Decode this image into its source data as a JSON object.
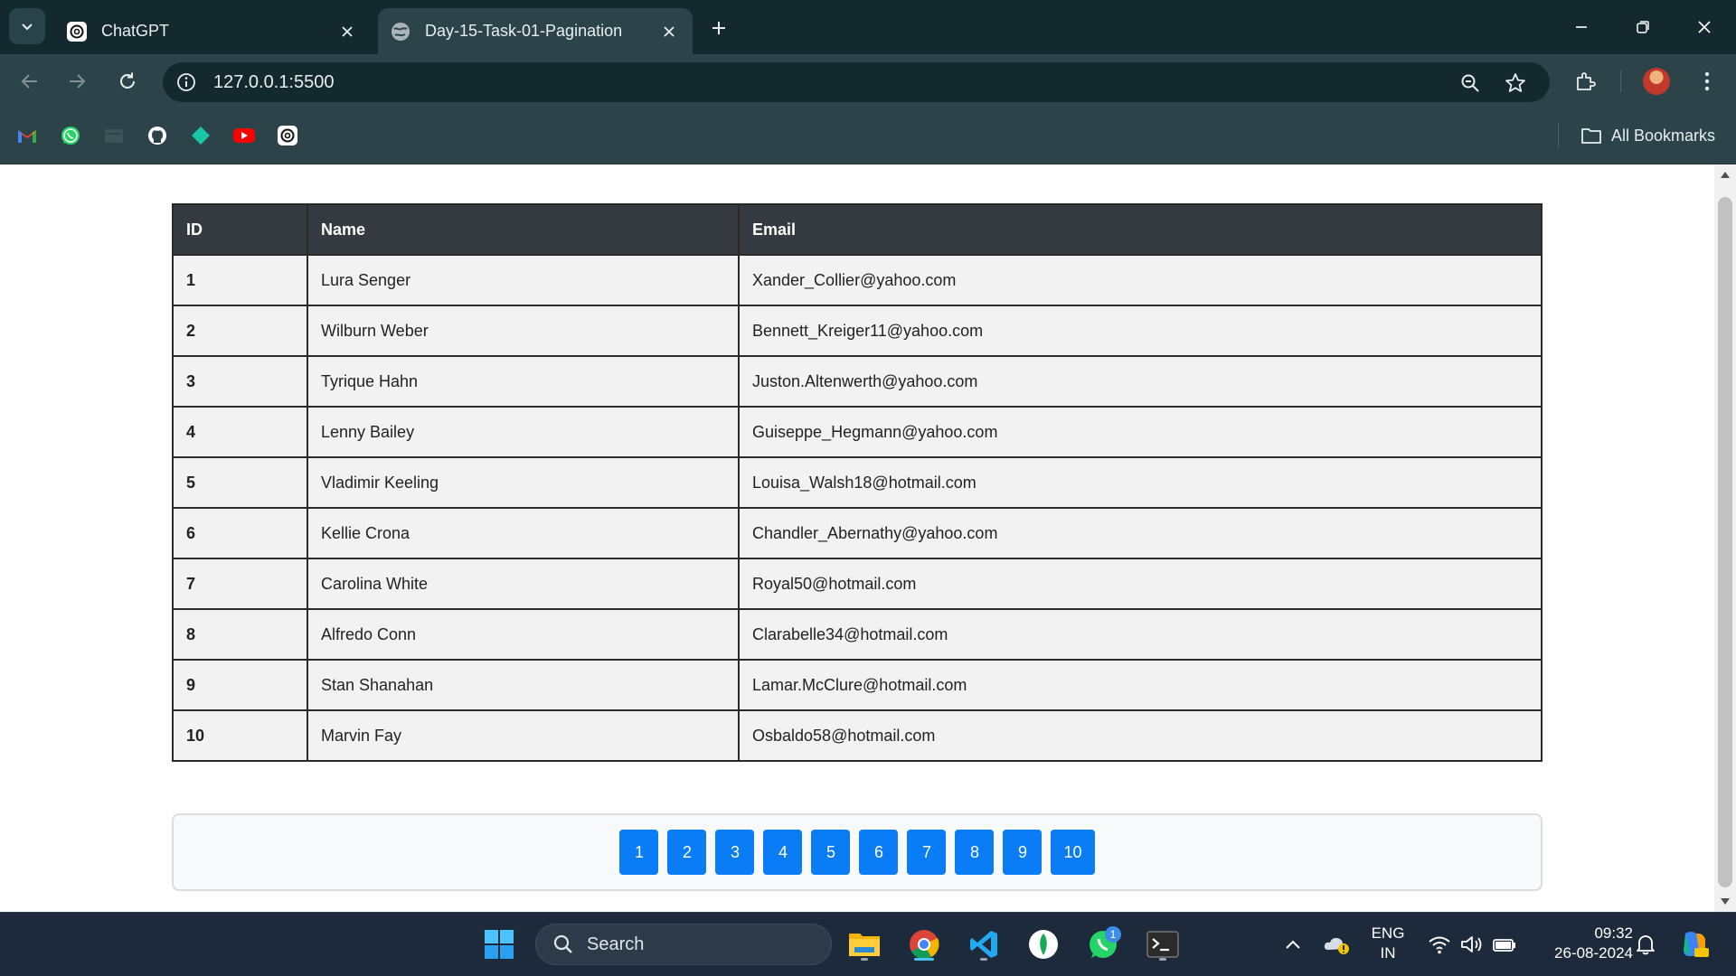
{
  "browser": {
    "tabs": [
      {
        "title": "ChatGPT",
        "favicon": "chatgpt-icon",
        "active": false
      },
      {
        "title": "Day-15-Task-01-Pagination",
        "favicon": "globe-icon",
        "active": true
      }
    ],
    "address_bar": {
      "url": "127.0.0.1:5500"
    },
    "bookmarks_bar": {
      "items": [
        "gmail-icon",
        "whatsapp-icon",
        "folder-icon",
        "github-icon",
        "diamond-icon",
        "youtube-icon",
        "chatgpt-icon"
      ],
      "all_bookmarks_label": "All Bookmarks"
    }
  },
  "page": {
    "table": {
      "headers": {
        "id": "ID",
        "name": "Name",
        "email": "Email"
      },
      "rows": [
        {
          "id": "1",
          "name": "Lura Senger",
          "email": "Xander_Collier@yahoo.com"
        },
        {
          "id": "2",
          "name": "Wilburn Weber",
          "email": "Bennett_Kreiger11@yahoo.com"
        },
        {
          "id": "3",
          "name": "Tyrique Hahn",
          "email": "Juston.Altenwerth@yahoo.com"
        },
        {
          "id": "4",
          "name": "Lenny Bailey",
          "email": "Guiseppe_Hegmann@yahoo.com"
        },
        {
          "id": "5",
          "name": "Vladimir Keeling",
          "email": "Louisa_Walsh18@hotmail.com"
        },
        {
          "id": "6",
          "name": "Kellie Crona",
          "email": "Chandler_Abernathy@yahoo.com"
        },
        {
          "id": "7",
          "name": "Carolina White",
          "email": "Royal50@hotmail.com"
        },
        {
          "id": "8",
          "name": "Alfredo Conn",
          "email": "Clarabelle34@hotmail.com"
        },
        {
          "id": "9",
          "name": "Stan Shanahan",
          "email": "Lamar.McClure@hotmail.com"
        },
        {
          "id": "10",
          "name": "Marvin Fay",
          "email": "Osbaldo58@hotmail.com"
        }
      ]
    },
    "pagination": {
      "pages": [
        "1",
        "2",
        "3",
        "4",
        "5",
        "6",
        "7",
        "8",
        "9",
        "10"
      ],
      "button_color": "#0a7cf5"
    }
  },
  "taskbar": {
    "search_label": "Search",
    "apps": [
      "windows-start-icon",
      "file-explorer-icon",
      "chrome-icon",
      "vscode-icon",
      "mongodb-compass-icon",
      "whatsapp-icon",
      "terminal-icon"
    ],
    "whatsapp_badge": "1",
    "language": {
      "line1": "ENG",
      "line2": "IN"
    },
    "clock": {
      "time": "09:32",
      "date": "26-08-2024"
    }
  },
  "colors": {
    "chrome_dark": "#13292e",
    "chrome_toolbar": "#2c4449",
    "table_header_bg": "#343a40",
    "table_row_bg": "#f2f2f2",
    "taskbar_bg": "#1c2a3b"
  }
}
